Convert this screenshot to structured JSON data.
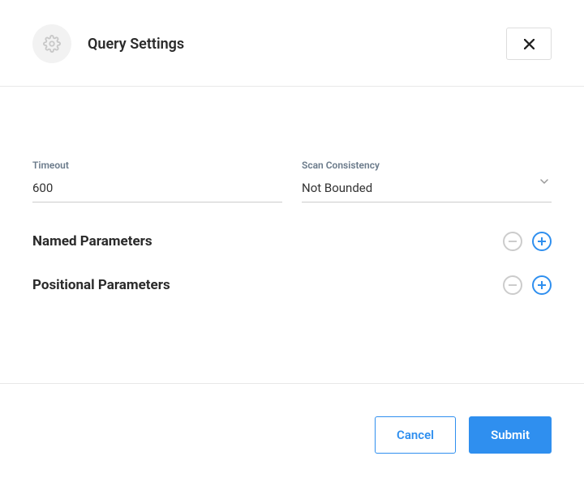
{
  "header": {
    "title": "Query Settings"
  },
  "form": {
    "timeout": {
      "label": "Timeout",
      "value": "600"
    },
    "scan_consistency": {
      "label": "Scan Consistency",
      "value": "Not Bounded"
    }
  },
  "sections": {
    "named": {
      "title": "Named Parameters"
    },
    "positional": {
      "title": "Positional Parameters"
    }
  },
  "footer": {
    "cancel_label": "Cancel",
    "submit_label": "Submit"
  }
}
